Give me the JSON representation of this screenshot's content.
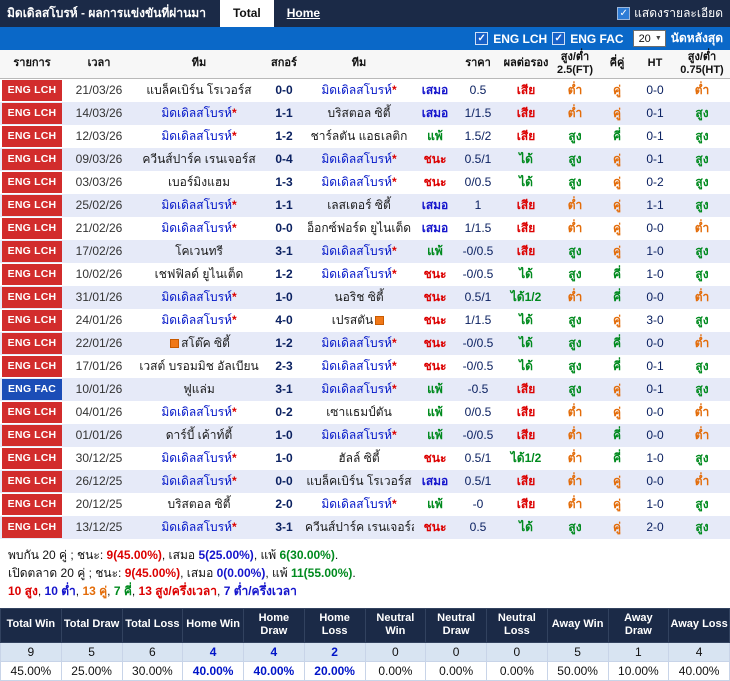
{
  "title_bar": {
    "title": "มิดเดิลสโบรห์ - ผลการแข่งขันที่ผ่านมา",
    "tabs": [
      {
        "label": "Total",
        "active": true
      },
      {
        "label": "Home",
        "active": false
      }
    ],
    "show_details_label": "แสดงรายละเอียด"
  },
  "filter_bar": {
    "leagues": [
      {
        "label": "ENG LCH",
        "checked": true
      },
      {
        "label": "ENG FAC",
        "checked": true
      }
    ],
    "matches_count": "20",
    "matches_count_label": "นัดหลังสุด"
  },
  "table": {
    "headers": [
      "รายการ",
      "เวลา",
      "ทีม",
      "สกอร์",
      "ทีม",
      "",
      "ราคา",
      "ผลต่อรอง",
      "สูง/ต่ำ 2.5(FT)",
      "คี่คู่",
      "HT",
      "สูง/ต่ำ 0.75(HT)"
    ],
    "rows": [
      {
        "league": "ENG LCH",
        "date": "21/03/26",
        "home": "แบล็คเบิร์น โรเวอร์ส",
        "home_focus": false,
        "home_badge": false,
        "score": "0-0",
        "away": "มิดเดิลสโบรห์",
        "away_focus": true,
        "away_badge": false,
        "result": "เสมอ",
        "odds": "0.5",
        "handicap": "เสีย",
        "over_under_ft": "ต่ำ",
        "odd_even": "คู่",
        "ht": "0-0",
        "over_under_ht": "ต่ำ"
      },
      {
        "league": "ENG LCH",
        "date": "14/03/26",
        "home": "มิดเดิลสโบรห์",
        "home_focus": true,
        "home_badge": false,
        "score": "1-1",
        "away": "บริสตอล ซิตี้",
        "away_focus": false,
        "away_badge": false,
        "result": "เสมอ",
        "odds": "1/1.5",
        "handicap": "เสีย",
        "over_under_ft": "ต่ำ",
        "odd_even": "คู่",
        "ht": "0-1",
        "over_under_ht": "สูง"
      },
      {
        "league": "ENG LCH",
        "date": "12/03/26",
        "home": "มิดเดิลสโบรห์",
        "home_focus": true,
        "home_badge": false,
        "score": "1-2",
        "away": "ชาร์ลตัน แอธเลติก",
        "away_focus": false,
        "away_badge": false,
        "result": "แพ้",
        "odds": "1.5/2",
        "handicap": "เสีย",
        "over_under_ft": "สูง",
        "odd_even": "คี่",
        "ht": "0-1",
        "over_under_ht": "สูง"
      },
      {
        "league": "ENG LCH",
        "date": "09/03/26",
        "home": "ควีนส์ปาร์ค เรนเจอร์ส",
        "home_focus": false,
        "home_badge": false,
        "score": "0-4",
        "away": "มิดเดิลสโบรห์",
        "away_focus": true,
        "away_badge": false,
        "result": "ชนะ",
        "odds": "0.5/1",
        "handicap": "ได้",
        "over_under_ft": "สูง",
        "odd_even": "คู่",
        "ht": "0-1",
        "over_under_ht": "สูง"
      },
      {
        "league": "ENG LCH",
        "date": "03/03/26",
        "home": "เบอร์มิงแฮม",
        "home_focus": false,
        "home_badge": false,
        "score": "1-3",
        "away": "มิดเดิลสโบรห์",
        "away_focus": true,
        "away_badge": false,
        "result": "ชนะ",
        "odds": "0/0.5",
        "handicap": "ได้",
        "over_under_ft": "สูง",
        "odd_even": "คู่",
        "ht": "0-2",
        "over_under_ht": "สูง"
      },
      {
        "league": "ENG LCH",
        "date": "25/02/26",
        "home": "มิดเดิลสโบรห์",
        "home_focus": true,
        "home_badge": false,
        "score": "1-1",
        "away": "เลสเตอร์ ซิตี้",
        "away_focus": false,
        "away_badge": false,
        "result": "เสมอ",
        "odds": "1",
        "handicap": "เสีย",
        "over_under_ft": "ต่ำ",
        "odd_even": "คู่",
        "ht": "1-1",
        "over_under_ht": "สูง"
      },
      {
        "league": "ENG LCH",
        "date": "21/02/26",
        "home": "มิดเดิลสโบรห์",
        "home_focus": true,
        "home_badge": false,
        "score": "0-0",
        "away": "อ็อกซ์ฟอร์ด ยูไนเต็ด",
        "away_focus": false,
        "away_badge": false,
        "result": "เสมอ",
        "odds": "1/1.5",
        "handicap": "เสีย",
        "over_under_ft": "ต่ำ",
        "odd_even": "คู่",
        "ht": "0-0",
        "over_under_ht": "ต่ำ"
      },
      {
        "league": "ENG LCH",
        "date": "17/02/26",
        "home": "โคเวนทรี",
        "home_focus": false,
        "home_badge": false,
        "score": "3-1",
        "away": "มิดเดิลสโบรห์",
        "away_focus": true,
        "away_badge": false,
        "result": "แพ้",
        "odds": "-0/0.5",
        "handicap": "เสีย",
        "over_under_ft": "สูง",
        "odd_even": "คู่",
        "ht": "1-0",
        "over_under_ht": "สูง"
      },
      {
        "league": "ENG LCH",
        "date": "10/02/26",
        "home": "เชฟฟิลด์ ยูไนเต็ด",
        "home_focus": false,
        "home_badge": false,
        "score": "1-2",
        "away": "มิดเดิลสโบรห์",
        "away_focus": true,
        "away_badge": false,
        "result": "ชนะ",
        "odds": "-0/0.5",
        "handicap": "ได้",
        "over_under_ft": "สูง",
        "odd_even": "คี่",
        "ht": "1-0",
        "over_under_ht": "สูง"
      },
      {
        "league": "ENG LCH",
        "date": "31/01/26",
        "home": "มิดเดิลสโบรห์",
        "home_focus": true,
        "home_badge": false,
        "score": "1-0",
        "away": "นอริช ซิตี้",
        "away_focus": false,
        "away_badge": false,
        "result": "ชนะ",
        "odds": "0.5/1",
        "handicap": "ได้1/2",
        "over_under_ft": "ต่ำ",
        "odd_even": "คี่",
        "ht": "0-0",
        "over_under_ht": "ต่ำ"
      },
      {
        "league": "ENG LCH",
        "date": "24/01/26",
        "home": "มิดเดิลสโบรห์",
        "home_focus": true,
        "home_badge": false,
        "score": "4-0",
        "away": "เปรสตัน",
        "away_focus": false,
        "away_badge": true,
        "result": "ชนะ",
        "odds": "1/1.5",
        "handicap": "ได้",
        "over_under_ft": "สูง",
        "odd_even": "คู่",
        "ht": "3-0",
        "over_under_ht": "สูง"
      },
      {
        "league": "ENG LCH",
        "date": "22/01/26",
        "home": "สโต๊ค ซิตี้",
        "home_focus": false,
        "home_badge": true,
        "score": "1-2",
        "away": "มิดเดิลสโบรห์",
        "away_focus": true,
        "away_badge": false,
        "result": "ชนะ",
        "odds": "-0/0.5",
        "handicap": "ได้",
        "over_under_ft": "สูง",
        "odd_even": "คี่",
        "ht": "0-0",
        "over_under_ht": "ต่ำ"
      },
      {
        "league": "ENG LCH",
        "date": "17/01/26",
        "home": "เวสต์ บรอมมิช อัลเบียน",
        "home_focus": false,
        "home_badge": false,
        "score": "2-3",
        "away": "มิดเดิลสโบรห์",
        "away_focus": true,
        "away_badge": false,
        "result": "ชนะ",
        "odds": "-0/0.5",
        "handicap": "ได้",
        "over_under_ft": "สูง",
        "odd_even": "คี่",
        "ht": "0-1",
        "over_under_ht": "สูง"
      },
      {
        "league": "ENG FAC",
        "date": "10/01/26",
        "home": "ฟูแล่ม",
        "home_focus": false,
        "home_badge": false,
        "score": "3-1",
        "away": "มิดเดิลสโบรห์",
        "away_focus": true,
        "away_badge": false,
        "result": "แพ้",
        "odds": "-0.5",
        "handicap": "เสีย",
        "over_under_ft": "สูง",
        "odd_even": "คู่",
        "ht": "0-1",
        "over_under_ht": "สูง"
      },
      {
        "league": "ENG LCH",
        "date": "04/01/26",
        "home": "มิดเดิลสโบรห์",
        "home_focus": true,
        "home_badge": false,
        "score": "0-2",
        "away": "เซาแธมป์ตัน",
        "away_focus": false,
        "away_badge": false,
        "result": "แพ้",
        "odds": "0/0.5",
        "handicap": "เสีย",
        "over_under_ft": "ต่ำ",
        "odd_even": "คู่",
        "ht": "0-0",
        "over_under_ht": "ต่ำ"
      },
      {
        "league": "ENG LCH",
        "date": "01/01/26",
        "home": "ดาร์บี้ เค้าท์ตี้",
        "home_focus": false,
        "home_badge": false,
        "score": "1-0",
        "away": "มิดเดิลสโบรห์",
        "away_focus": true,
        "away_badge": false,
        "result": "แพ้",
        "odds": "-0/0.5",
        "handicap": "เสีย",
        "over_under_ft": "ต่ำ",
        "odd_even": "คี่",
        "ht": "0-0",
        "over_under_ht": "ต่ำ"
      },
      {
        "league": "ENG LCH",
        "date": "30/12/25",
        "home": "มิดเดิลสโบรห์",
        "home_focus": true,
        "home_badge": false,
        "score": "1-0",
        "away": "ฮัลล์ ซิตี้",
        "away_focus": false,
        "away_badge": false,
        "result": "ชนะ",
        "odds": "0.5/1",
        "handicap": "ได้1/2",
        "over_under_ft": "ต่ำ",
        "odd_even": "คี่",
        "ht": "1-0",
        "over_under_ht": "สูง"
      },
      {
        "league": "ENG LCH",
        "date": "26/12/25",
        "home": "มิดเดิลสโบรห์",
        "home_focus": true,
        "home_badge": false,
        "score": "0-0",
        "away": "แบล็คเบิร์น โรเวอร์ส",
        "away_focus": false,
        "away_badge": false,
        "result": "เสมอ",
        "odds": "0.5/1",
        "handicap": "เสีย",
        "over_under_ft": "ต่ำ",
        "odd_even": "คู่",
        "ht": "0-0",
        "over_under_ht": "ต่ำ"
      },
      {
        "league": "ENG LCH",
        "date": "20/12/25",
        "home": "บริสตอล ซิตี้",
        "home_focus": false,
        "home_badge": false,
        "score": "2-0",
        "away": "มิดเดิลสโบรห์",
        "away_focus": true,
        "away_badge": false,
        "result": "แพ้",
        "odds": "-0",
        "handicap": "เสีย",
        "over_under_ft": "ต่ำ",
        "odd_even": "คู่",
        "ht": "1-0",
        "over_under_ht": "สูง"
      },
      {
        "league": "ENG LCH",
        "date": "13/12/25",
        "home": "มิดเดิลสโบรห์",
        "home_focus": true,
        "home_badge": false,
        "score": "3-1",
        "away": "ควีนส์ปาร์ค เรนเจอร์ส",
        "away_focus": false,
        "away_badge": false,
        "result": "ชนะ",
        "odds": "0.5",
        "handicap": "ได้",
        "over_under_ft": "สูง",
        "odd_even": "คู่",
        "ht": "2-0",
        "over_under_ht": "สูง"
      }
    ]
  },
  "summary_lines": [
    [
      {
        "t": "พบกัน 20 คู่ ; ชนะ: ",
        "c": "#111111"
      },
      {
        "t": "9(45.00%)",
        "c": "#dc0000"
      },
      {
        "t": ", เสมอ ",
        "c": "#111111"
      },
      {
        "t": "5(25.00%)",
        "c": "#1414cc"
      },
      {
        "t": ", แพ้ ",
        "c": "#111111"
      },
      {
        "t": "6(30.00%)",
        "c": "#008a1e"
      },
      {
        "t": ".",
        "c": "#111111"
      }
    ],
    [
      {
        "t": "เปิดตลาด 20 คู่ ; ชนะ: ",
        "c": "#111111"
      },
      {
        "t": "9(45.00%)",
        "c": "#dc0000"
      },
      {
        "t": ", เสมอ ",
        "c": "#111111"
      },
      {
        "t": "0(0.00%)",
        "c": "#1414cc"
      },
      {
        "t": ", แพ้ ",
        "c": "#111111"
      },
      {
        "t": "11(55.00%)",
        "c": "#008a1e"
      },
      {
        "t": ".",
        "c": "#111111"
      }
    ],
    [
      {
        "t": "10 สูง",
        "c": "#dc0000"
      },
      {
        "t": ", ",
        "c": "#111111"
      },
      {
        "t": "10 ต่ำ",
        "c": "#1414cc"
      },
      {
        "t": ", ",
        "c": "#111111"
      },
      {
        "t": "13 คู่",
        "c": "#e36c09"
      },
      {
        "t": ", ",
        "c": "#111111"
      },
      {
        "t": "7 คี่",
        "c": "#008a1e"
      },
      {
        "t": ", ",
        "c": "#111111"
      },
      {
        "t": "13 สูง/ครึ่งเวลา",
        "c": "#dc0000"
      },
      {
        "t": ", ",
        "c": "#111111"
      },
      {
        "t": "7 ต่ำ/ครึ่งเวลา",
        "c": "#1414cc"
      }
    ]
  ],
  "stats_table": {
    "headers": [
      "Total Win",
      "Total Draw",
      "Total Loss",
      "Home Win",
      "Home Draw",
      "Home Loss",
      "Neutral Win",
      "Neutral Draw",
      "Neutral Loss",
      "Away Win",
      "Away Draw",
      "Away Loss"
    ],
    "values": [
      "9",
      "5",
      "6",
      "4",
      "4",
      "2",
      "0",
      "0",
      "0",
      "5",
      "1",
      "4"
    ],
    "percents": [
      "45.00%",
      "25.00%",
      "30.00%",
      "40.00%",
      "40.00%",
      "20.00%",
      "0.00%",
      "0.00%",
      "0.00%",
      "50.00%",
      "10.00%",
      "40.00%"
    ],
    "highlight_columns": [
      3,
      4,
      5
    ]
  },
  "colors": {
    "win": "#dc0000",
    "draw": "#1414cc",
    "lose": "#008a1e",
    "gain": "#008a1e",
    "concede": "#dc0000",
    "over": "#008a1e",
    "under": "#e36c09",
    "even": "#e36c09",
    "odd": "#008a1e",
    "league_lch": "#d22c2c",
    "league_fac": "#1b4db7",
    "focus_team": "#0014c8",
    "top_bar": "#1b2a47",
    "filter_bar": "#0a68c8"
  }
}
